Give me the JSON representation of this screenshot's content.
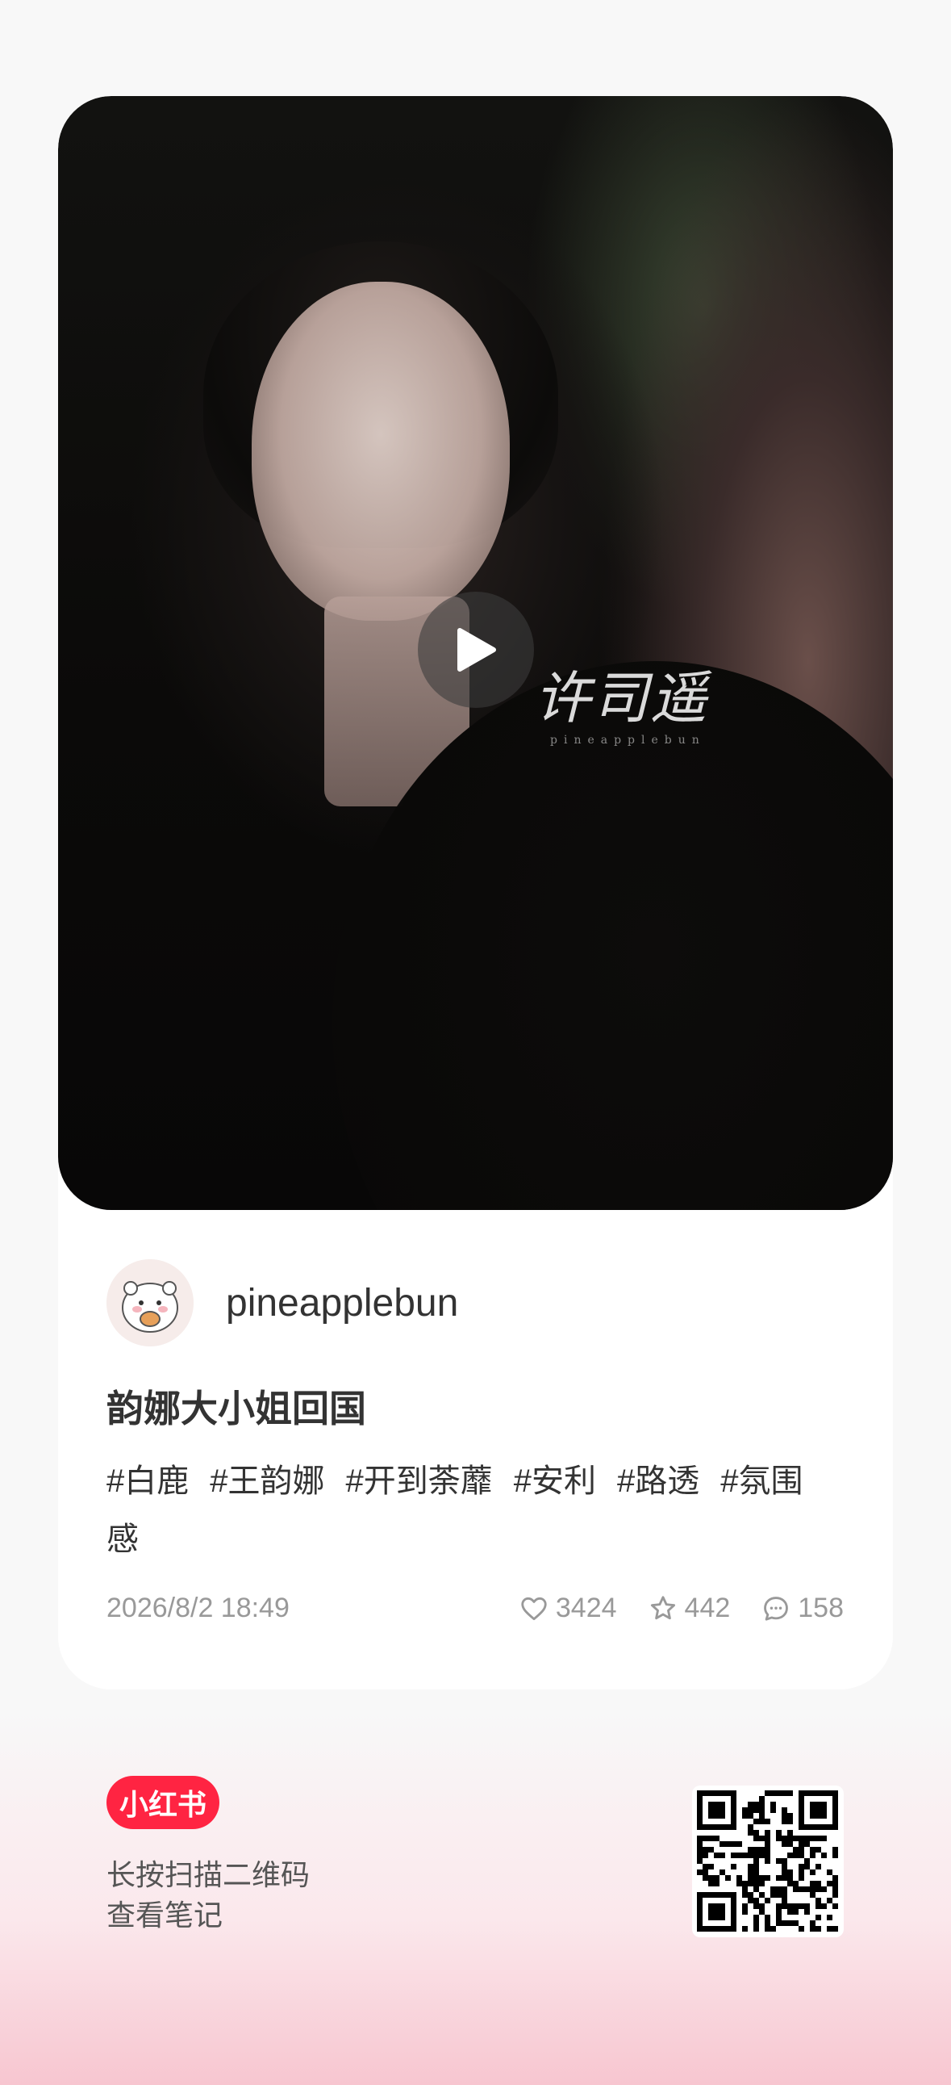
{
  "note": {
    "author": "pineapplebun",
    "title": "韵娜大小姐回国",
    "tags": [
      "#白鹿",
      "#王韵娜",
      "#开到荼蘼",
      "#安利",
      "#路透",
      "#氛围感"
    ],
    "date": "2026/8/2 18:49",
    "likes": "3424",
    "collects": "442",
    "comments": "158",
    "watermark": "许司遥",
    "watermark_sub": "pineapplebun"
  },
  "footer": {
    "logo": "小红书",
    "line1": "长按扫描二维码",
    "line2": "查看笔记"
  },
  "icons": {
    "play": "play-icon",
    "like": "heart-icon",
    "collect": "star-icon",
    "comment": "comment-icon"
  },
  "colors": {
    "brand": "#ff2442",
    "meta": "#999999",
    "text": "#333333"
  }
}
